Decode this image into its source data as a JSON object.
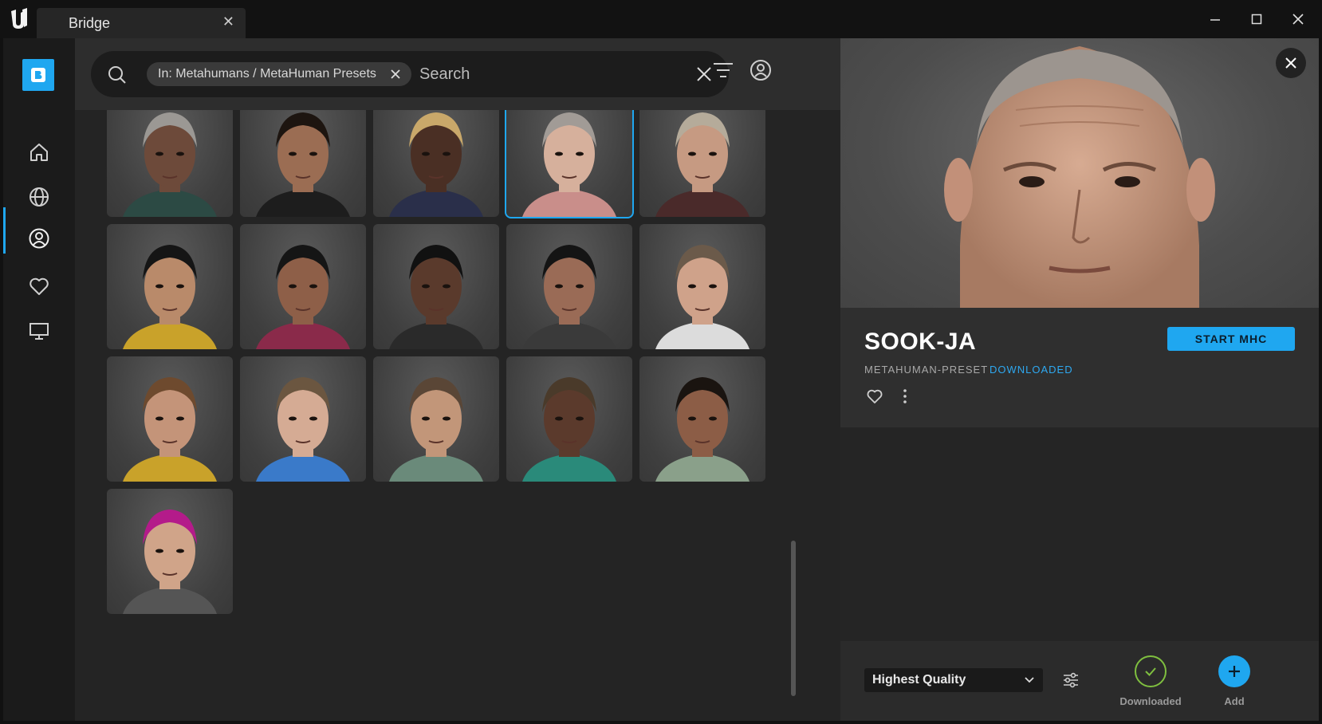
{
  "window": {
    "tab_title": "Bridge"
  },
  "search": {
    "filter_chip": "In: Metahumans / MetaHuman Presets",
    "placeholder": "Search"
  },
  "asset": {
    "name": "SOOK-JA",
    "type": "METAHUMAN-PRESET",
    "status": "DOWNLOADED",
    "primary_action": "START MHC"
  },
  "footer": {
    "quality": "Highest Quality",
    "downloaded_label": "Downloaded",
    "add_label": "Add"
  },
  "colors": {
    "accent": "#1fa7f0",
    "downloaded_green": "#7fbf3f"
  },
  "icons": {
    "sidebar": [
      "home-icon",
      "globe-icon",
      "user-circle-icon",
      "heart-icon",
      "monitor-icon"
    ]
  }
}
